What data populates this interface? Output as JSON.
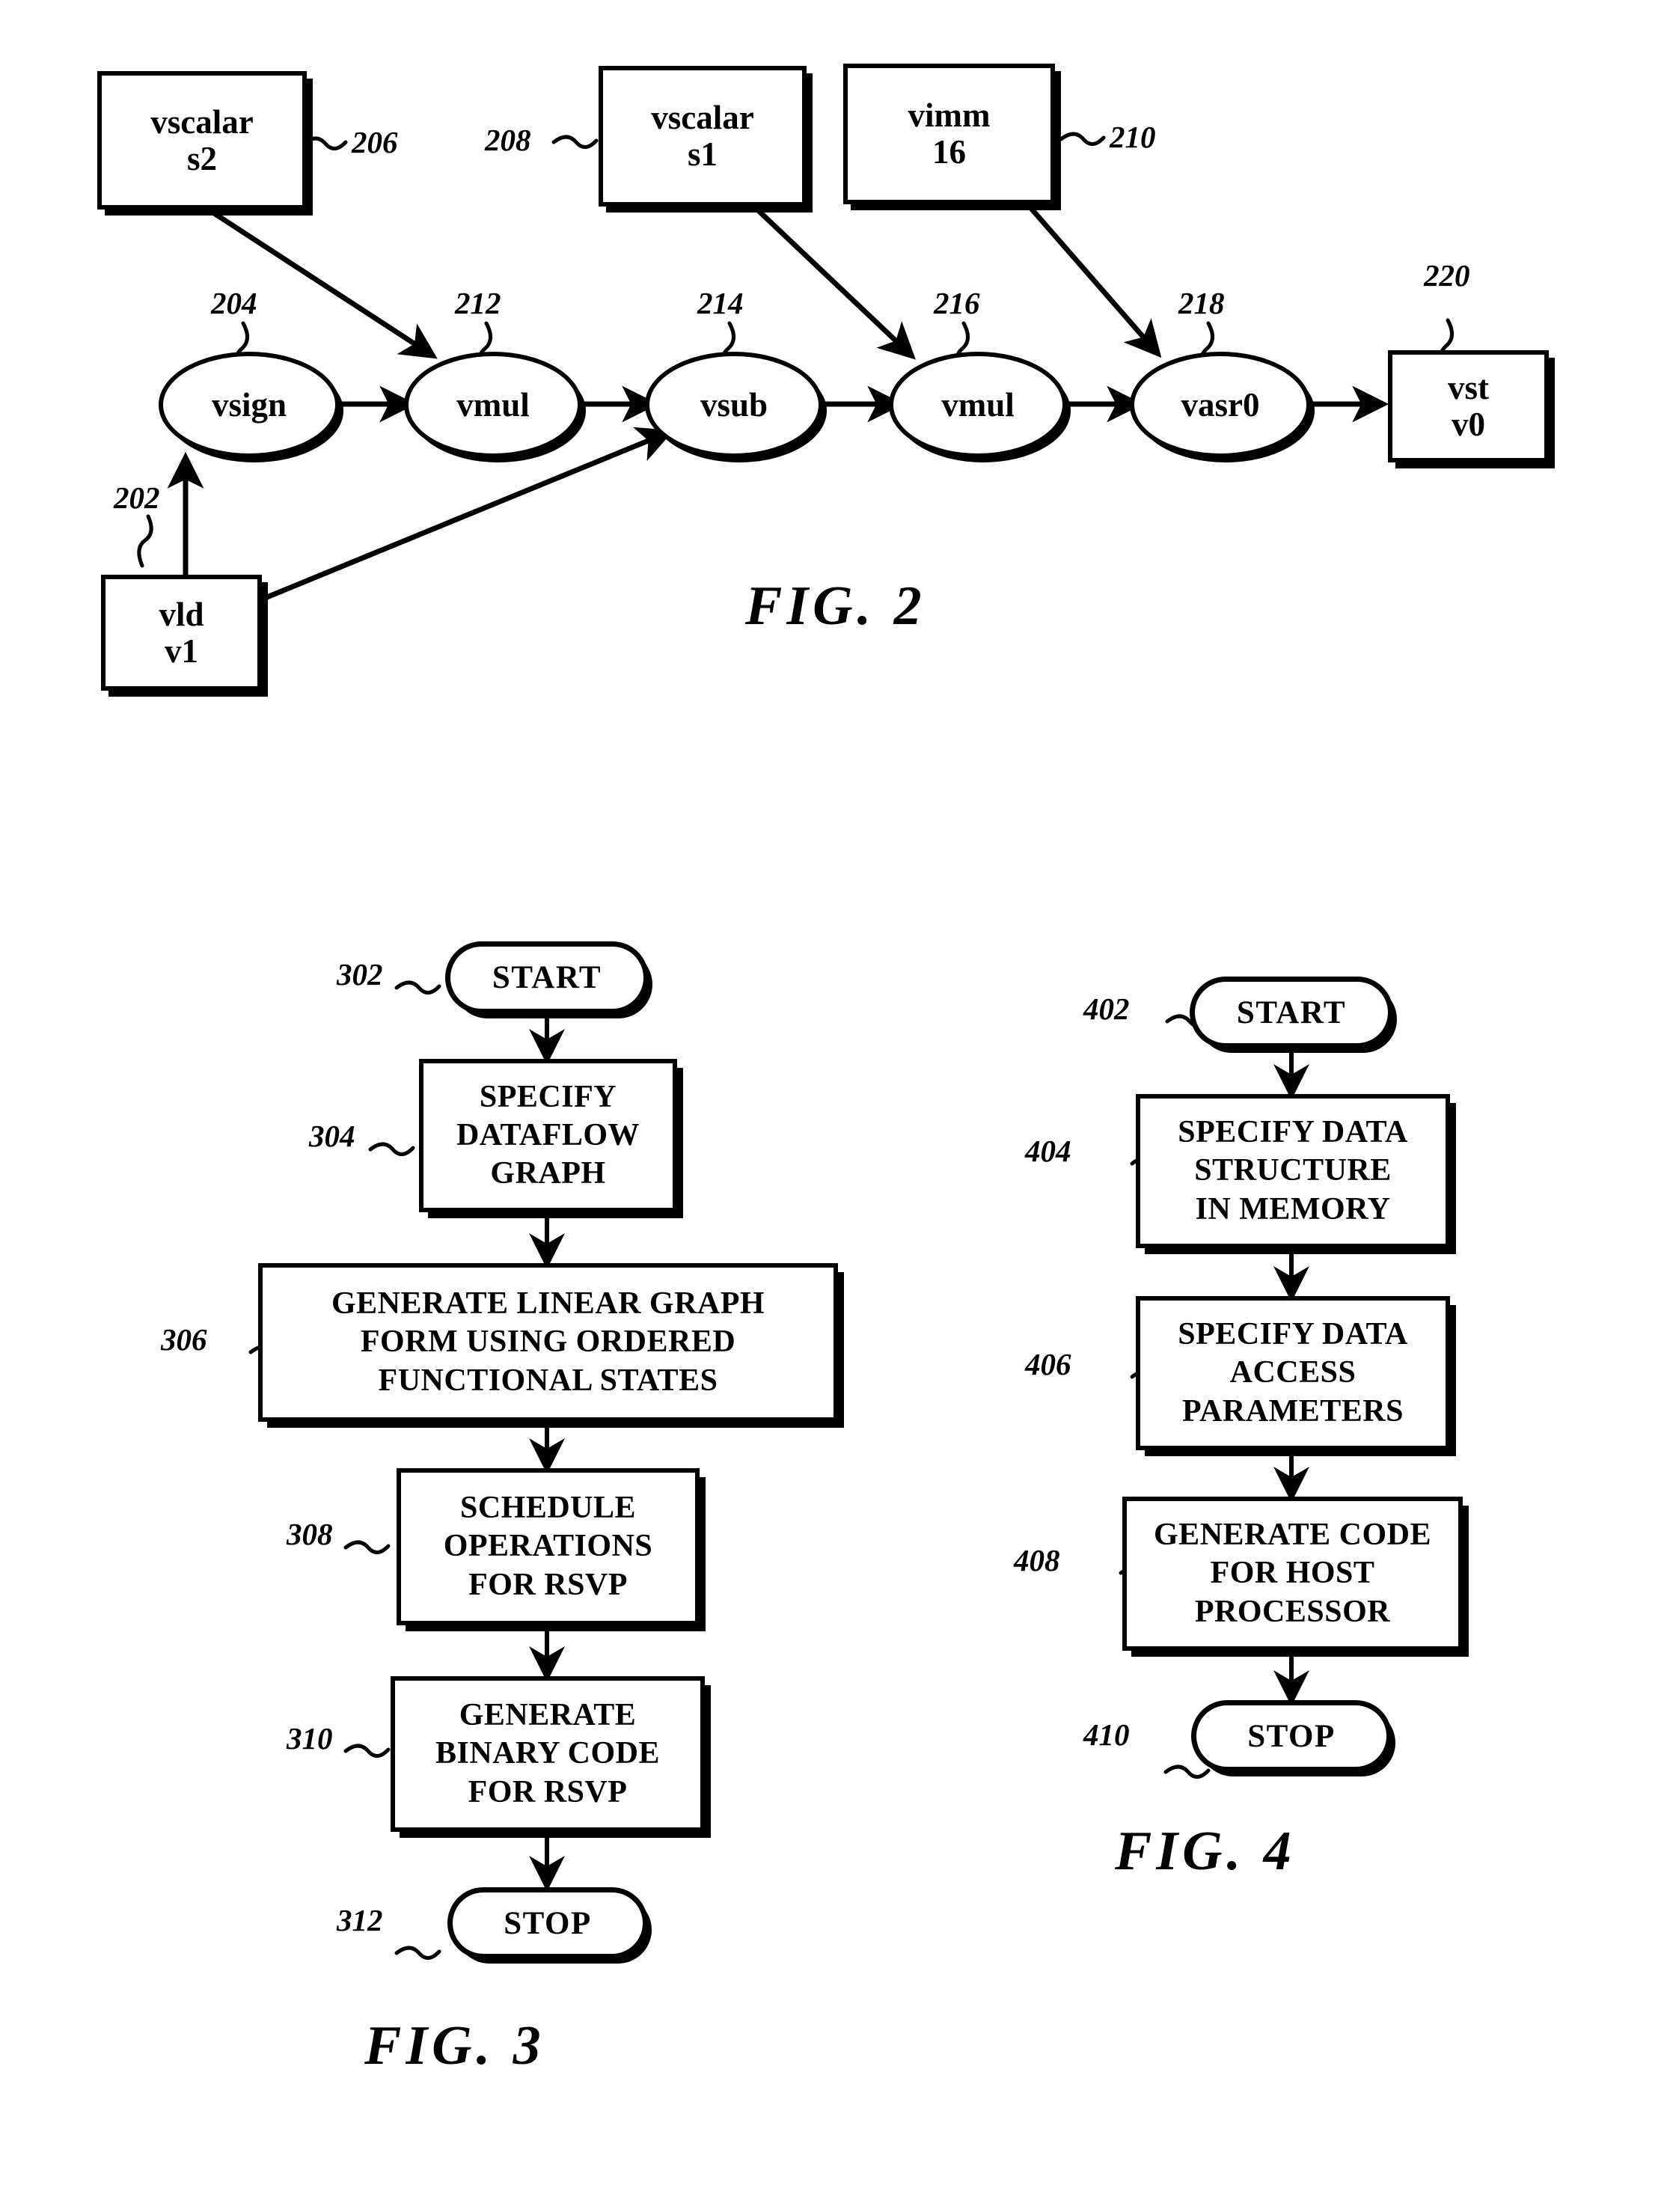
{
  "document": {
    "type": "patent-drawing-sheet",
    "figures": [
      "FIG. 2",
      "FIG. 3",
      "FIG. 4"
    ]
  },
  "fig2": {
    "caption": "FIG. 2",
    "nodes": {
      "vscalar_s2": {
        "ref": "206",
        "line1": "vscalar",
        "line2": "s2",
        "shape": "rect"
      },
      "vscalar_s1": {
        "ref": "208",
        "line1": "vscalar",
        "line2": "s1",
        "shape": "rect"
      },
      "vimm_16": {
        "ref": "210",
        "line1": "vimm",
        "line2": "16",
        "shape": "rect"
      },
      "vld_v1": {
        "ref": "202",
        "line1": "vld",
        "line2": "v1",
        "shape": "rect"
      },
      "vst_v0": {
        "ref": "220",
        "line1": "vst",
        "line2": "v0",
        "shape": "rect"
      },
      "vsign": {
        "ref": "204",
        "label": "vsign",
        "shape": "ellipse"
      },
      "vmul1": {
        "ref": "212",
        "label": "vmul",
        "shape": "ellipse"
      },
      "vsub": {
        "ref": "214",
        "label": "vsub",
        "shape": "ellipse"
      },
      "vmul2": {
        "ref": "216",
        "label": "vmul",
        "shape": "ellipse"
      },
      "vasr0": {
        "ref": "218",
        "label": "vasr0",
        "shape": "ellipse"
      }
    },
    "edges": [
      {
        "from": "vld_v1",
        "to": "vsign"
      },
      {
        "from": "vld_v1",
        "to": "vsub"
      },
      {
        "from": "vsign",
        "to": "vmul1"
      },
      {
        "from": "vscalar_s2",
        "to": "vmul1"
      },
      {
        "from": "vmul1",
        "to": "vsub"
      },
      {
        "from": "vsub",
        "to": "vmul2"
      },
      {
        "from": "vscalar_s1",
        "to": "vmul2"
      },
      {
        "from": "vmul2",
        "to": "vasr0"
      },
      {
        "from": "vimm_16",
        "to": "vasr0"
      },
      {
        "from": "vasr0",
        "to": "vst_v0"
      }
    ]
  },
  "fig3": {
    "caption": "FIG. 3",
    "steps": [
      {
        "ref": "302",
        "kind": "terminal",
        "lines": [
          "START"
        ]
      },
      {
        "ref": "304",
        "kind": "process",
        "lines": [
          "SPECIFY",
          "DATAFLOW",
          "GRAPH"
        ]
      },
      {
        "ref": "306",
        "kind": "process",
        "lines": [
          "GENERATE LINEAR GRAPH",
          "FORM USING ORDERED",
          "FUNCTIONAL STATES"
        ]
      },
      {
        "ref": "308",
        "kind": "process",
        "lines": [
          "SCHEDULE",
          "OPERATIONS",
          "FOR RSVP"
        ]
      },
      {
        "ref": "310",
        "kind": "process",
        "lines": [
          "GENERATE",
          "BINARY CODE",
          "FOR RSVP"
        ]
      },
      {
        "ref": "312",
        "kind": "terminal",
        "lines": [
          "STOP"
        ]
      }
    ]
  },
  "fig4": {
    "caption": "FIG. 4",
    "steps": [
      {
        "ref": "402",
        "kind": "terminal",
        "lines": [
          "START"
        ]
      },
      {
        "ref": "404",
        "kind": "process",
        "lines": [
          "SPECIFY DATA",
          "STRUCTURE",
          "IN MEMORY"
        ]
      },
      {
        "ref": "406",
        "kind": "process",
        "lines": [
          "SPECIFY DATA",
          "ACCESS",
          "PARAMETERS"
        ]
      },
      {
        "ref": "408",
        "kind": "process",
        "lines": [
          "GENERATE CODE",
          "FOR HOST",
          "PROCESSOR"
        ]
      },
      {
        "ref": "410",
        "kind": "terminal",
        "lines": [
          "STOP"
        ]
      }
    ]
  },
  "colors": {
    "ink": "#000000",
    "paper": "#ffffff"
  }
}
